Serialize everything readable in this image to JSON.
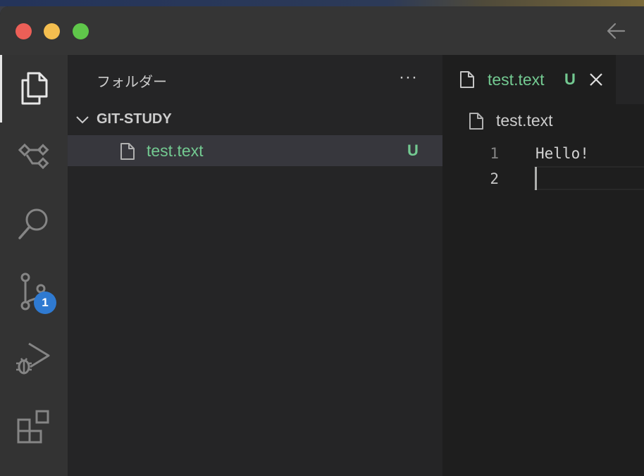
{
  "sidebar": {
    "title": "フォルダー",
    "more_label": "···",
    "folder": {
      "name": "GIT-STUDY"
    },
    "files": [
      {
        "name": "test.text",
        "status": "U"
      }
    ]
  },
  "activity_bar": {
    "items": [
      {
        "icon": "files-icon"
      },
      {
        "icon": "outline-icon"
      },
      {
        "icon": "search-icon"
      },
      {
        "icon": "source-control-icon",
        "badge": "1"
      },
      {
        "icon": "run-debug-icon"
      },
      {
        "icon": "extensions-icon"
      }
    ]
  },
  "editor": {
    "tab": {
      "label": "test.text",
      "status": "U"
    },
    "breadcrumb": "test.text",
    "lines": [
      {
        "number": "1",
        "text": "Hello!"
      },
      {
        "number": "2",
        "text": ""
      }
    ]
  },
  "colors": {
    "untracked": "#73c991",
    "badge": "#2f7ad1",
    "sidebar_bg": "#252526",
    "activity_bg": "#333333",
    "editor_bg": "#1e1e1e"
  }
}
